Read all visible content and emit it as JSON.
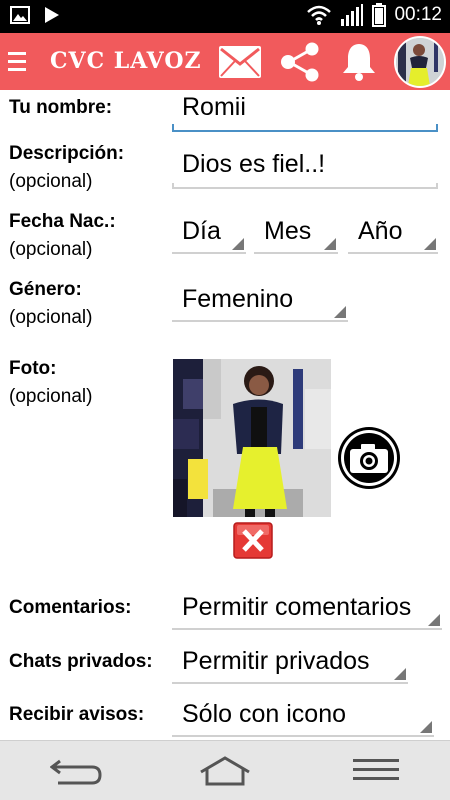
{
  "status_bar": {
    "time": "00:12",
    "icons": [
      "image-icon",
      "play-icon",
      "wifi-icon",
      "signal-icon",
      "battery-icon"
    ]
  },
  "app_bar": {
    "title": "CVC LAVOZ",
    "icons": [
      "menu-icon",
      "mail-icon",
      "share-icon",
      "bell-icon",
      "avatar"
    ],
    "color": "#f15a5c"
  },
  "form": {
    "name": {
      "label": "Tu nombre:",
      "value": "Romii"
    },
    "description": {
      "label": "Descripción:",
      "optional": "(opcional)",
      "value": "Dios es fiel..!"
    },
    "birthdate": {
      "label": "Fecha Nac.:",
      "optional": "(opcional)",
      "day": "Día",
      "month": "Mes",
      "year": "Año"
    },
    "gender": {
      "label": "Género:",
      "optional": "(opcional)",
      "value": "Femenino"
    },
    "photo": {
      "label": "Foto:",
      "optional": "(opcional)"
    },
    "comments": {
      "label": "Comentarios:",
      "value": "Permitir comentarios"
    },
    "private_chats": {
      "label": "Chats privados:",
      "value": "Permitir privados"
    },
    "notifications": {
      "label": "Recibir avisos:",
      "value": "Sólo con icono"
    }
  },
  "nav_bar": {
    "icons": [
      "back-icon",
      "home-icon",
      "menu-lines-icon"
    ]
  },
  "colors": {
    "accent": "#f15a5c",
    "focus": "#4a90c6",
    "delete": "#e53935"
  }
}
